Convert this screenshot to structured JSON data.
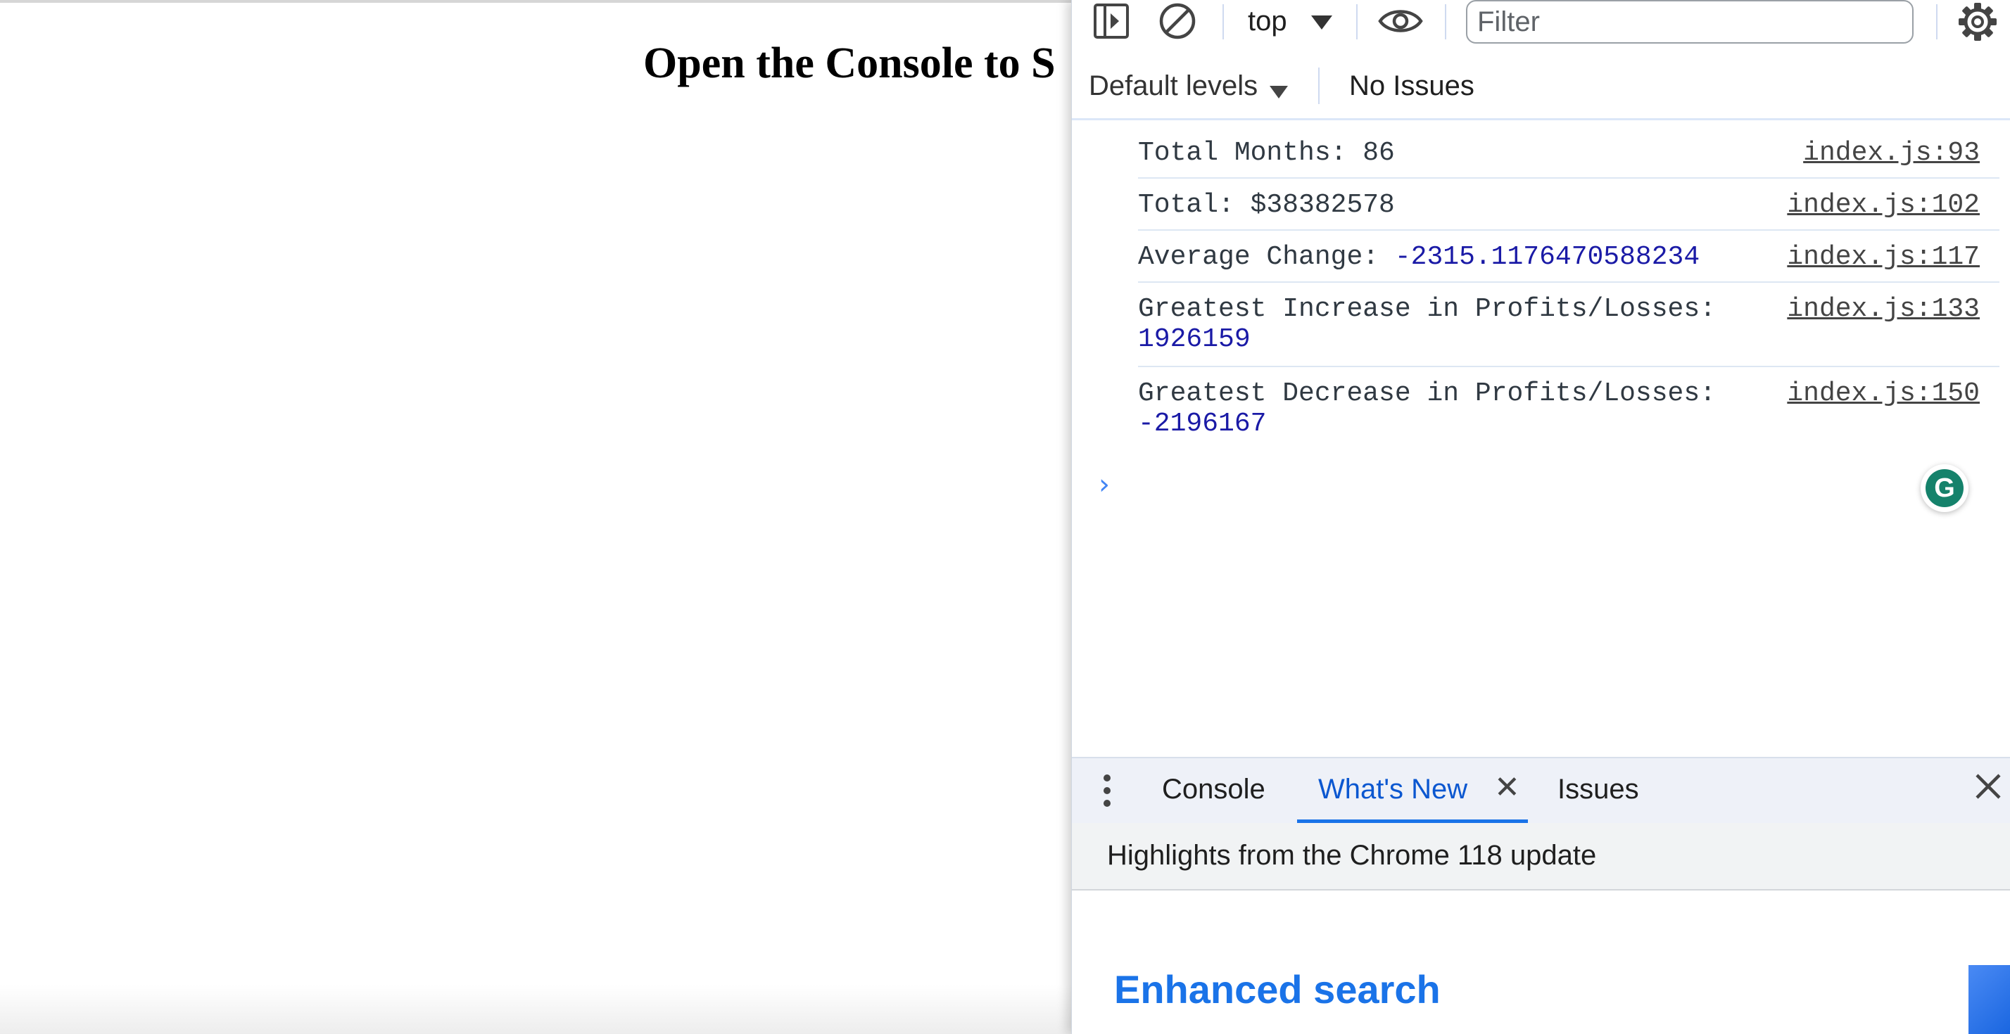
{
  "page": {
    "heading": "Open the Console to S"
  },
  "devtools": {
    "toolbar": {
      "context_value": "top",
      "filter_placeholder": "Filter",
      "levels_label": "Default levels",
      "issues_label": "No Issues"
    },
    "console": {
      "messages": [
        {
          "text": "Total Months: 86",
          "value": "",
          "source": "index.js:93"
        },
        {
          "text": "Total: $38382578",
          "value": "",
          "source": "index.js:102"
        },
        {
          "text": "Average Change: ",
          "value": "-2315.1176470588234",
          "source": "index.js:117"
        },
        {
          "text": "Greatest Increase in Profits/Losses:",
          "value": "1926159",
          "source": "index.js:133"
        },
        {
          "text": "Greatest Decrease in Profits/Losses:",
          "value": "-2196167",
          "source": "index.js:150"
        }
      ],
      "prompt_symbol": "›"
    },
    "drawer": {
      "tabs": [
        {
          "label": "Console"
        },
        {
          "label": "What's New"
        },
        {
          "label": "Issues"
        }
      ],
      "tab_close_symbol": "✕",
      "highlights": "Highlights from the Chrome 118 update",
      "section_title": "Enhanced search"
    },
    "colors": {
      "accent": "#1a73e8",
      "number": "#1a1aa6",
      "grammarly": "#15826b"
    }
  }
}
